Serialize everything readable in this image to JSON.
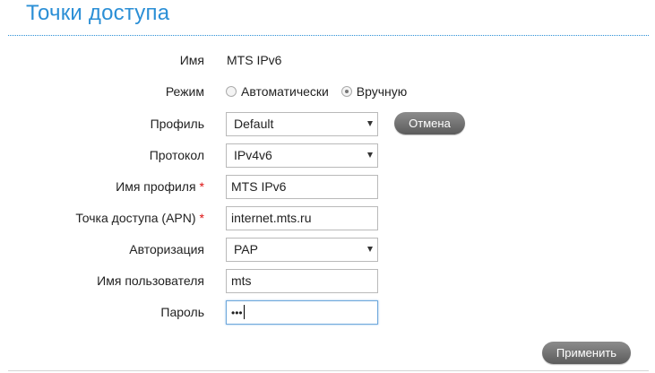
{
  "page": {
    "title": "Точки доступа"
  },
  "form": {
    "name": {
      "label": "Имя",
      "value": "MTS IPv6"
    },
    "mode": {
      "label": "Режим",
      "options": [
        "Автоматически",
        "Вручную"
      ],
      "selected": "Вручную"
    },
    "profile": {
      "label": "Профиль",
      "value": "Default"
    },
    "protocol": {
      "label": "Протокол",
      "value": "IPv4v6"
    },
    "profile_name": {
      "label": "Имя профиля",
      "required_mark": "*",
      "value": "MTS IPv6"
    },
    "apn": {
      "label": "Точка доступа (APN)",
      "required_mark": "*",
      "value": "internet.mts.ru"
    },
    "auth": {
      "label": "Авторизация",
      "value": "PAP"
    },
    "username": {
      "label": "Имя пользователя",
      "value": "mts"
    },
    "password": {
      "label": "Пароль",
      "value": "•••"
    }
  },
  "buttons": {
    "cancel": "Отмена",
    "apply": "Применить"
  },
  "colors": {
    "title": "#2b8fd6",
    "required": "#dd1111",
    "button": "#6e6e6e"
  }
}
